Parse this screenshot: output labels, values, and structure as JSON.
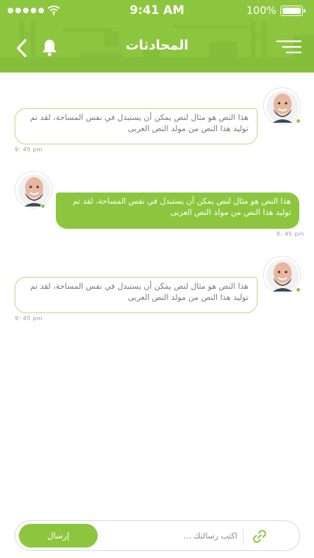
{
  "status_bar": {
    "time": "9:41 AM",
    "battery": "100%",
    "battery_level": 1.0
  },
  "header": {
    "title": "المحادثات",
    "icons": {
      "back": "chevron-left-icon",
      "notifications": "bell-icon",
      "menu": "menu-icon"
    }
  },
  "messages": [
    {
      "direction": "in",
      "text": "هذا النص هو مثال لنص يمكن أن يستبدل في نفس المساحة، لقد تم توليد هذا النص من مولد النص العربى",
      "time": "9: 45 pm"
    },
    {
      "direction": "out",
      "text": "هذا النص هو مثال لنص يمكن أن يستبدل في نفس المساحة، لقد تم توليد هذا النص من مولد النص العربى",
      "time": "9: 45 pm"
    },
    {
      "direction": "in",
      "text": "هذا النص هو مثال لنص يمكن أن يستبدل في نفس المساحة، لقد تم توليد هذا النص من مولد النص العربى",
      "time": "9: 45 pm"
    }
  ],
  "composer": {
    "placeholder": "اكتب رسالتك ...",
    "send_label": "إرسال",
    "attach_icon": "link-icon"
  },
  "colors": {
    "brand": "#8cc63f",
    "bubble_border": "#b8dc7d",
    "online": "#8cc63f"
  }
}
